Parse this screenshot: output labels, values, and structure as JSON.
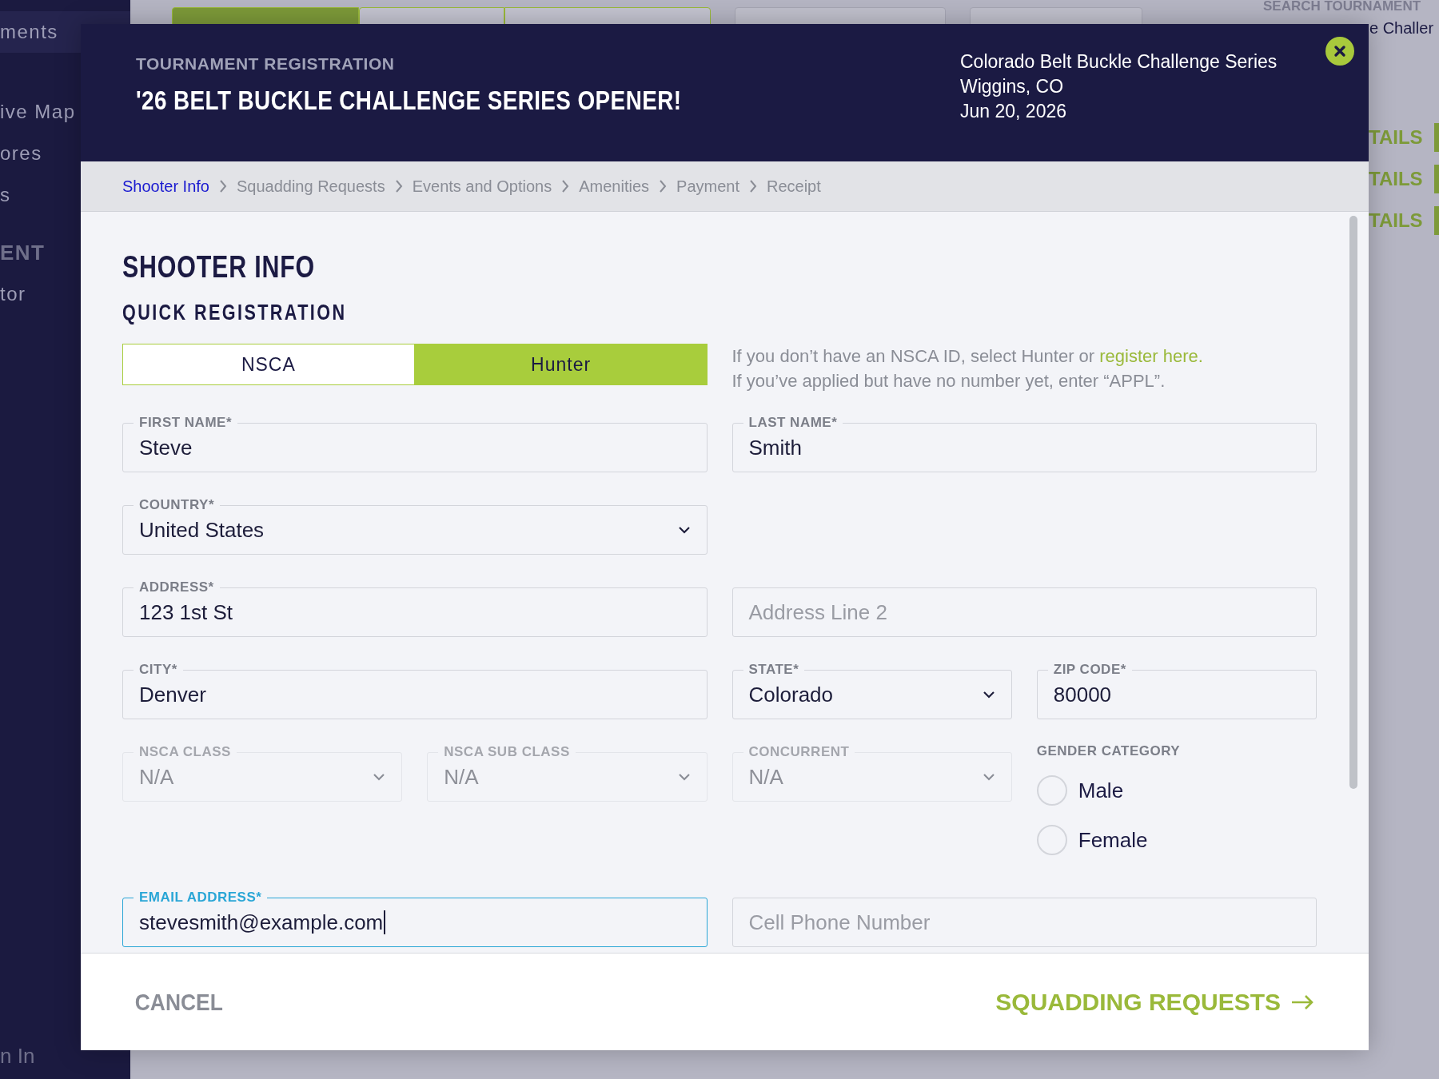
{
  "background": {
    "sidebar_items": [
      {
        "label": "ments",
        "kind": "item",
        "selected": true
      },
      {
        "label": "ive Map",
        "kind": "item",
        "selected": false
      },
      {
        "label": "ores",
        "kind": "item",
        "selected": false
      },
      {
        "label": "s",
        "kind": "item",
        "selected": false
      },
      {
        "label": "ENT",
        "kind": "heading",
        "selected": false
      },
      {
        "label": "tor",
        "kind": "item",
        "selected": false
      }
    ],
    "filter_tabs": [
      {
        "selected": true
      },
      {
        "selected": false
      },
      {
        "selected": false
      }
    ],
    "sidebar_footer": "n In",
    "search_label": "SEARCH TOURNAMENT",
    "search_value": "e Challer",
    "details_links": [
      "TAILS",
      "TAILS",
      "TAILS"
    ]
  },
  "modal": {
    "eyebrow": "TOURNAMENT REGISTRATION",
    "title": "'26 BELT BUCKLE CHALLENGE SERIES OPENER!",
    "event_lines": [
      "Colorado Belt Buckle Challenge Series",
      "Wiggins, CO",
      "Jun 20, 2026"
    ],
    "steps": [
      {
        "label": "Shooter Info",
        "selected": true
      },
      {
        "label": "Squadding Requests",
        "selected": false
      },
      {
        "label": "Events and Options",
        "selected": false
      },
      {
        "label": "Amenities",
        "selected": false
      },
      {
        "label": "Payment",
        "selected": false
      },
      {
        "label": "Receipt",
        "selected": false
      }
    ],
    "section_title": "SHOOTER INFO",
    "subsection_title": "QUICK REGISTRATION",
    "membership_toggle": [
      {
        "label": "NSCA",
        "selected": false
      },
      {
        "label": "Hunter",
        "selected": true
      }
    ],
    "help_lines": [
      "If you don’t have an NSCA ID, select Hunter or",
      "If you’ve applied but have no number yet, enter “APPL”."
    ],
    "help_link": "register here.",
    "rows": [
      {
        "left": [
          {
            "kind": "text",
            "label": "FIRST NAME*",
            "value": "Steve"
          }
        ],
        "right": [
          {
            "kind": "text",
            "label": "LAST NAME*",
            "value": "Smith"
          }
        ]
      },
      {
        "left": [
          {
            "kind": "select",
            "label": "COUNTRY*",
            "value": "United States"
          }
        ]
      },
      {
        "left": [
          {
            "kind": "text",
            "label": "ADDRESS*",
            "value": "123 1st St"
          }
        ],
        "right": [
          {
            "kind": "text",
            "placeholder": "Address Line 2"
          }
        ]
      },
      {
        "left": [
          {
            "kind": "text",
            "label": "CITY*",
            "value": "Denver"
          }
        ],
        "right": [
          {
            "kind": "select",
            "label": "STATE*",
            "value": "Colorado"
          },
          {
            "kind": "text",
            "label": "ZIP CODE*",
            "value": "80000"
          }
        ]
      },
      {
        "left": [
          {
            "kind": "select",
            "label": "NSCA CLASS",
            "value": "N/A",
            "disabled": true
          },
          {
            "kind": "select",
            "label": "NSCA SUB CLASS",
            "value": "N/A",
            "disabled": true
          }
        ],
        "right": [
          {
            "kind": "select",
            "label": "CONCURRENT",
            "value": "N/A",
            "disabled": true
          },
          {
            "kind": "radio",
            "label": "GENDER CATEGORY",
            "options": [
              {
                "label": "Male",
                "selected": false
              },
              {
                "label": "Female",
                "selected": false
              }
            ]
          }
        ]
      },
      {
        "left": [
          {
            "kind": "text",
            "label": "EMAIL ADDRESS*",
            "value": "stevesmith@example.com",
            "focused": true
          }
        ],
        "right": [
          {
            "kind": "text",
            "placeholder": "Cell Phone Number"
          }
        ]
      }
    ],
    "cancel": "CANCEL",
    "next": "SQUADDING REQUESTS"
  }
}
